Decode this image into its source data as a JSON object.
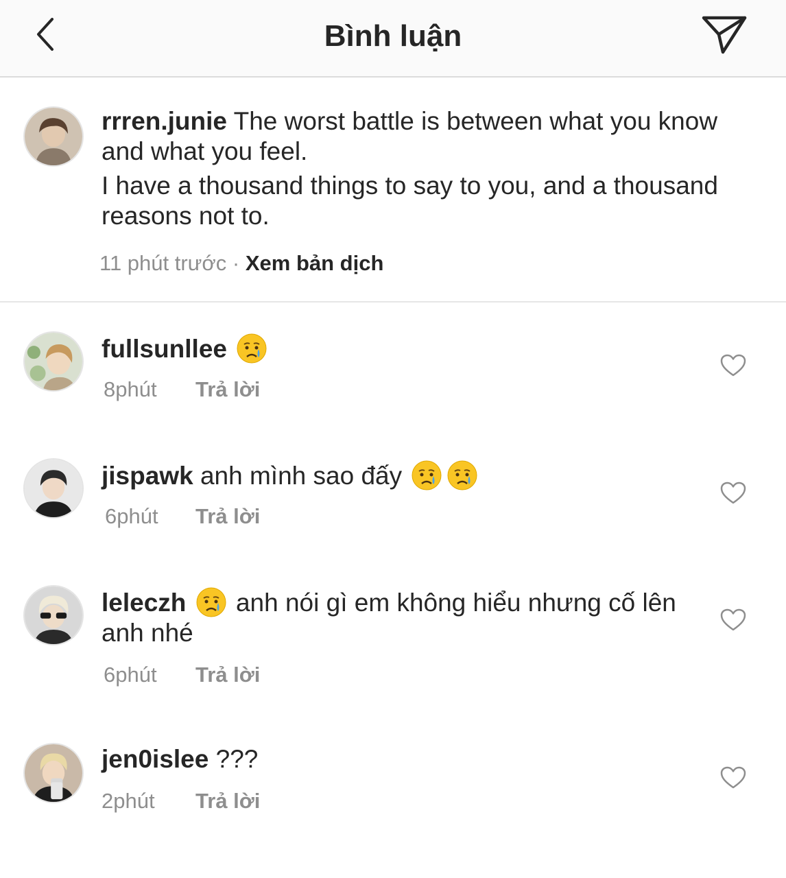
{
  "header": {
    "title": "Bình luận",
    "back_icon": "chevron-left-icon",
    "share_icon": "paper-plane-icon"
  },
  "caption": {
    "username": "rrren.junie",
    "line1": "The worst battle is between what you know and what you feel.",
    "line2": "I have a thousand things to say to you, and a thousand reasons not to.",
    "time": "11 phút trước",
    "separator": "·",
    "translate": "Xem bản dịch"
  },
  "comments": [
    {
      "username": "fullsunllee",
      "text_before": "",
      "text_after": "",
      "emoji_count": 1,
      "time": "8phút",
      "reply": "Trả lời"
    },
    {
      "username": "jispawk",
      "text_before": "anh mình sao đấy",
      "text_after": "",
      "emoji_count": 2,
      "time": "6phút",
      "reply": "Trả lời"
    },
    {
      "username": "leleczh",
      "text_before": "",
      "text_after": "anh nói gì em không hiểu nhưng cố lên anh nhé",
      "emoji_count": 1,
      "time": "6phút",
      "reply": "Trả lời"
    },
    {
      "username": "jen0islee",
      "text_before": "???",
      "text_after": "",
      "emoji_count": 0,
      "time": "2phút",
      "reply": "Trả lời"
    }
  ],
  "colors": {
    "text": "#262626",
    "muted": "#8e8e8e",
    "header_bg": "#fafafa",
    "divider": "#dbdbdb"
  },
  "emoji_name": "crying-face-emoji"
}
